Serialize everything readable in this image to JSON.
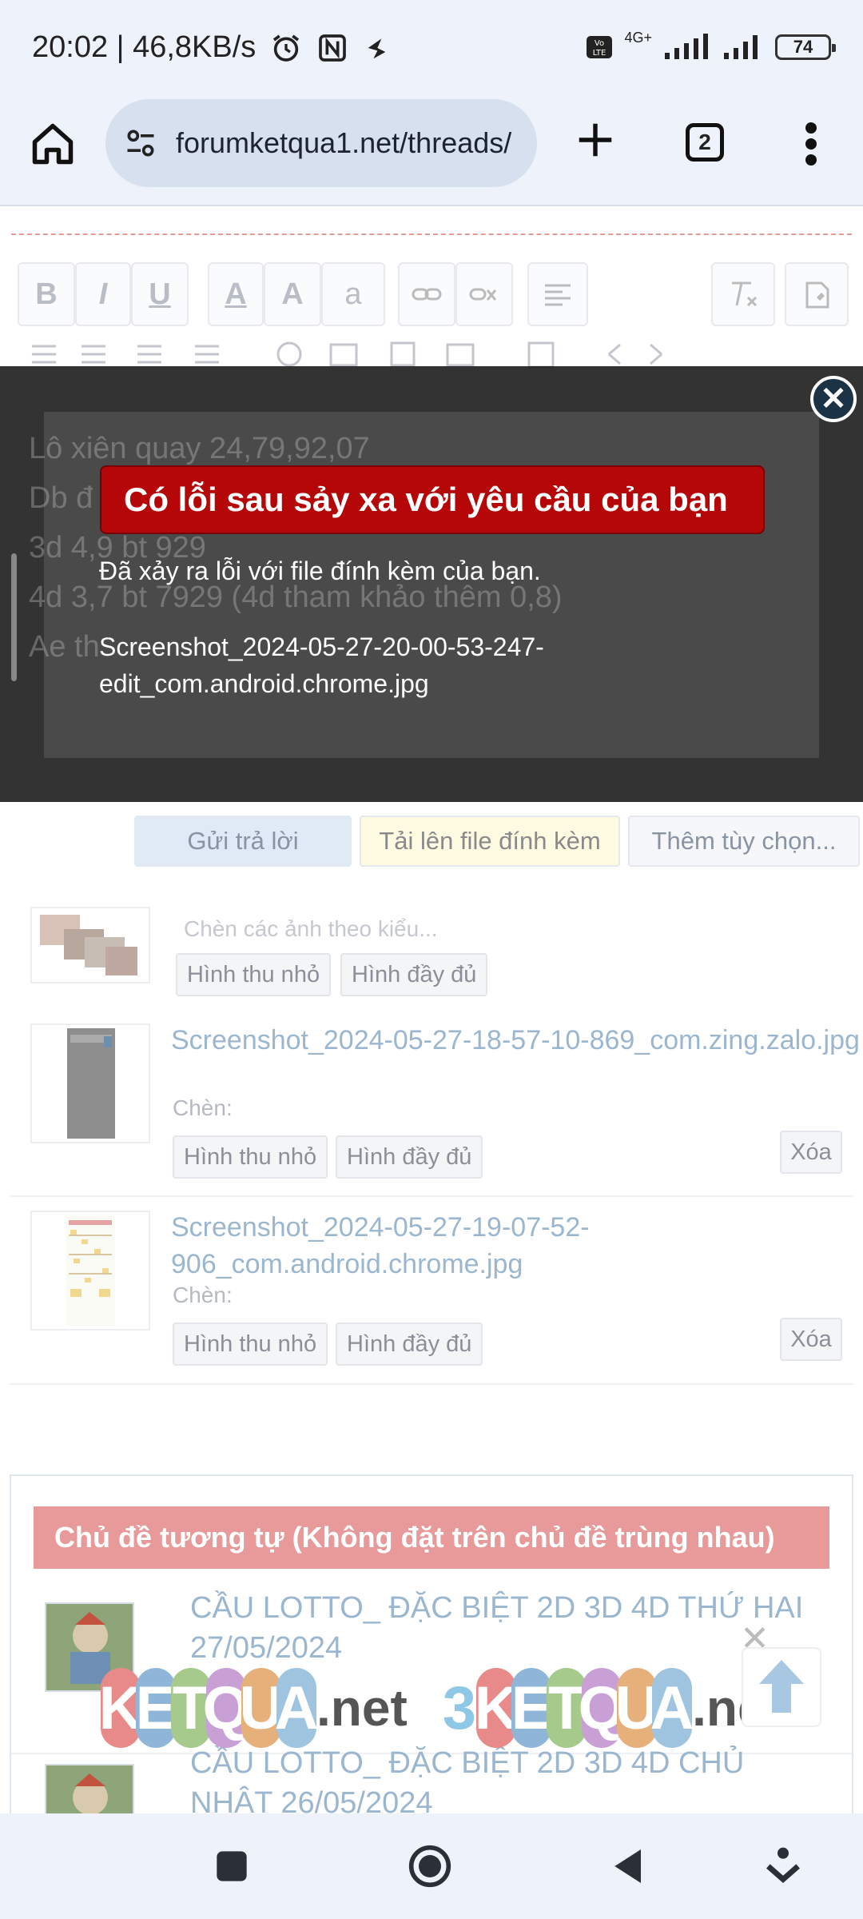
{
  "status_bar": {
    "time_speed": "20:02 | 46,8KB/s",
    "network": "4G+",
    "battery": "74"
  },
  "browser": {
    "url": "forumketqua1.net/threads/",
    "tab_count": "2"
  },
  "editor_text_behind_overlay": [
    "Lô xiên quay 24,79,92,07",
    "Db đ",
    "3d 4,9 bt 929",
    "4d 3,7 bt 7929 (4d tham khảo thêm 0,8)",
    "Ae th"
  ],
  "error_dialog": {
    "title": "Có lỗi sau sảy xa với yêu cầu của bạn",
    "message": "Đã xảy ra lỗi với file đính kèm của bạn.",
    "filename": "Screenshot_2024-05-27-20-00-53-247-edit_com.android.chrome.jpg",
    "close_symbol": "✕"
  },
  "form_buttons": {
    "reply": "Gửi trả lời",
    "upload": "Tải lên file đính kèm",
    "more_options": "Thêm tùy chọn..."
  },
  "insert_all": {
    "label": "Chèn các ảnh theo kiểu...",
    "thumb_btn": "Hình thu nhỏ",
    "full_btn": "Hình đầy đủ"
  },
  "attachments": [
    {
      "name": "Screenshot_2024-05-27-18-57-10-869_com.zing.zalo.jpg",
      "insert_label": "Chèn:",
      "thumb_btn": "Hình thu nhỏ",
      "full_btn": "Hình đầy đủ",
      "delete": "Xóa"
    },
    {
      "name": "Screenshot_2024-05-27-19-07-52-906_com.android.chrome.jpg",
      "insert_label": "Chèn:",
      "thumb_btn": "Hình thu nhỏ",
      "full_btn": "Hình đầy đủ",
      "delete": "Xóa"
    }
  ],
  "similar_threads": {
    "heading": "Chủ đề tương tự (Không đặt trên chủ đề trùng nhau)",
    "items": [
      "CẦU LOTTO_ ĐẶC BIỆT 2D 3D 4D THỨ HAI 27/05/2024",
      "CẦU LOTTO_ ĐẶC BIỆT 2D 3D 4D CHỦ NHẬT 26/05/2024"
    ]
  },
  "banner": {
    "left_letters": [
      "K",
      "E",
      "T",
      "Q",
      "U",
      "A"
    ],
    "right_prefix": "3",
    "right_letters": [
      "K",
      "E",
      "T",
      "Q",
      "U",
      "A"
    ],
    "suffix": ".net",
    "colors": [
      "#e98a8a",
      "#8fb6d9",
      "#a6c98c",
      "#c9a0d6",
      "#e6b07a",
      "#9ec4e0"
    ],
    "close_symbol": "✕"
  },
  "editor_toolbar": {
    "bold": "B",
    "italic": "I",
    "underline": "U",
    "font_color": "A",
    "font_size": "A",
    "font_family": "a"
  }
}
